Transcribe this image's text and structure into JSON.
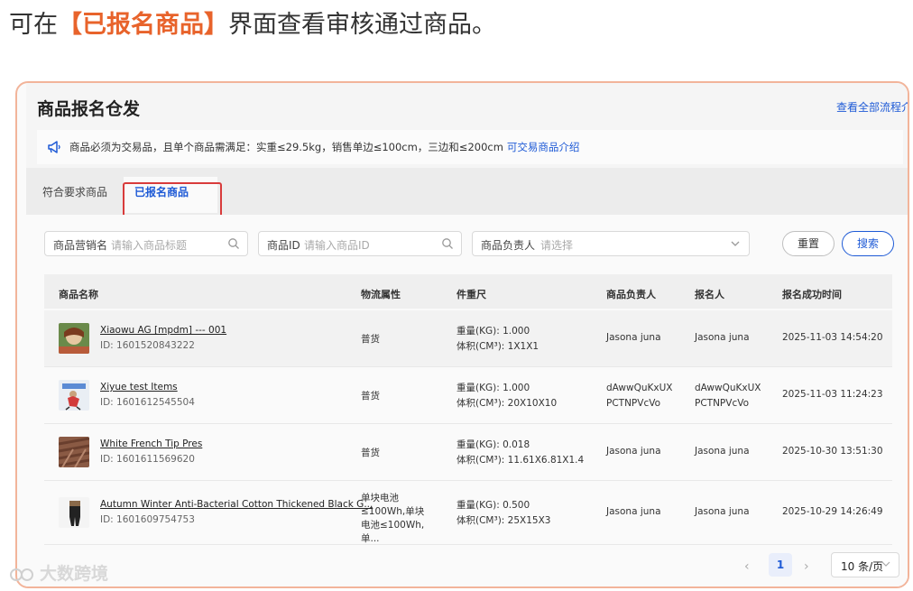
{
  "caption": {
    "prefix": "可在",
    "highlight": "【已报名商品】",
    "suffix": "界面查看审核通过商品。"
  },
  "panel": {
    "title": "商品报名仓发",
    "top_link": "查看全部流程介绍"
  },
  "notice": {
    "icon": "megaphone-icon",
    "text": "商品必须为交易品，且单个商品需满足：实重≤29.5kg，销售单边≤100cm，三边和≤200cm",
    "link": "可交易商品介绍"
  },
  "tabs": [
    {
      "label": "符合要求商品",
      "active": false
    },
    {
      "label": "已报名商品",
      "active": true
    }
  ],
  "filters": {
    "marketing_name": {
      "label": "商品营销名",
      "placeholder": "请输入商品标题"
    },
    "product_id": {
      "label": "商品ID",
      "placeholder": "请输入商品ID"
    },
    "owner": {
      "label": "商品负责人",
      "placeholder": "请选择"
    },
    "reset_label": "重置",
    "search_label": "搜索"
  },
  "table": {
    "headers": [
      "商品名称",
      "物流属性",
      "件重尺",
      "商品负责人",
      "报名人",
      "报名成功时间"
    ],
    "rows": [
      {
        "name": "Xiaowu AG [mpdm] --- 001",
        "id": "ID: 1601520843222",
        "logistics": "普货",
        "weight": "重量(KG): 1.000",
        "volume": "体积(CM³): 1X1X1",
        "owner": "Jasona juna",
        "registrant": "Jasona juna",
        "time": "2025-11-03 14:54:20"
      },
      {
        "name": "Xiyue test Items",
        "id": "ID: 1601612545504",
        "logistics": "普货",
        "weight": "重量(KG): 1.000",
        "volume": "体积(CM³): 20X10X10",
        "owner_line1": "dAwwQuKxUX",
        "owner_line2": "PCTNPVcVo",
        "registrant_line1": "dAwwQuKxUX",
        "registrant_line2": "PCTNPVcVo",
        "time": "2025-11-03 11:24:23"
      },
      {
        "name": "White French Tip Pres",
        "id": "ID: 1601611569620",
        "logistics": "普货",
        "weight": "重量(KG): 0.018",
        "volume": "体积(CM³): 11.61X6.81X1.4",
        "owner": "Jasona juna",
        "registrant": "Jasona juna",
        "time": "2025-10-30 13:51:30"
      },
      {
        "name": "Autumn Winter Anti-Bacterial Cotton Thickened Black G...",
        "id": "ID: 1601609754753",
        "logistics": "单块电池≤100Wh,单块电池≤100Wh,单...",
        "weight": "重量(KG): 0.500",
        "volume": "体积(CM³): 25X15X3",
        "owner": "Jasona juna",
        "registrant": "Jasona juna",
        "time": "2025-10-29 14:26:49"
      }
    ]
  },
  "pagination": {
    "prev": "‹",
    "page": "1",
    "next": "›",
    "page_size": "10 条/页"
  },
  "watermark": "大数跨境",
  "colors": {
    "accent": "#1e5ad6",
    "highlight": "#e8632b",
    "annotation_box": "#d83b3b",
    "frame_border": "#f2b49a"
  }
}
